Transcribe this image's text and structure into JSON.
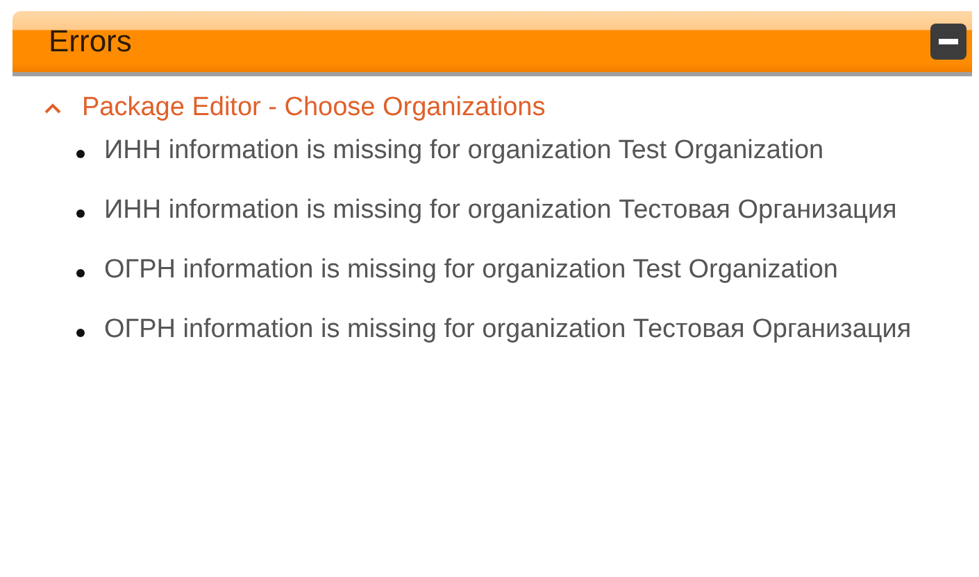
{
  "panel": {
    "title": "Errors",
    "collapsed": false
  },
  "groups": [
    {
      "title": "Package Editor - Choose Organizations",
      "expanded": true,
      "items": [
        "ИНН information is missing for organization Test Organization",
        "ИНН information is missing for organization Тестовая Организация",
        "ОГРН information is missing for organization Test Organization",
        "ОГРН information is missing for organization Тестовая Организация"
      ]
    }
  ]
}
